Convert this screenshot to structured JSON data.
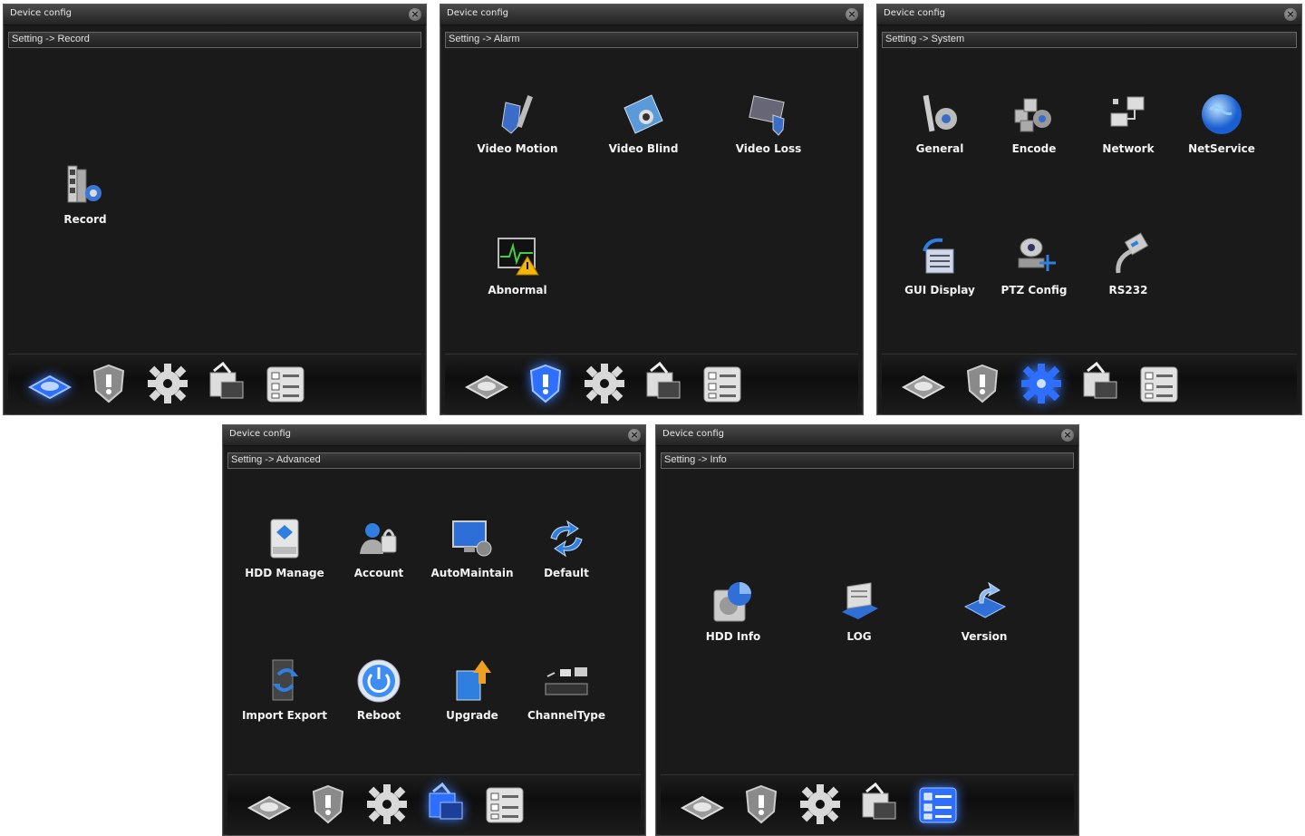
{
  "windows": [
    {
      "title": "Device config",
      "breadcrumb": "Setting -> Record",
      "active_tool": 0,
      "items": [
        {
          "label": "Record",
          "icon": "record-icon"
        }
      ]
    },
    {
      "title": "Device config",
      "breadcrumb": "Setting -> Alarm",
      "active_tool": 1,
      "items": [
        {
          "label": "Video Motion",
          "icon": "video-motion-icon"
        },
        {
          "label": "Video Blind",
          "icon": "video-blind-icon"
        },
        {
          "label": "Video Loss",
          "icon": "video-loss-icon"
        },
        {
          "label": "Abnormal",
          "icon": "abnormal-icon"
        }
      ]
    },
    {
      "title": "Device config",
      "breadcrumb": "Setting -> System",
      "active_tool": 2,
      "items": [
        {
          "label": "General",
          "icon": "general-icon"
        },
        {
          "label": "Encode",
          "icon": "encode-icon"
        },
        {
          "label": "Network",
          "icon": "network-icon"
        },
        {
          "label": "NetService",
          "icon": "netservice-icon"
        },
        {
          "label": "GUI Display",
          "icon": "gui-display-icon"
        },
        {
          "label": "PTZ Config",
          "icon": "ptz-config-icon"
        },
        {
          "label": "RS232",
          "icon": "rs232-icon"
        }
      ]
    },
    {
      "title": "Device config",
      "breadcrumb": "Setting -> Advanced",
      "active_tool": 3,
      "items": [
        {
          "label": "HDD Manage",
          "icon": "hdd-manage-icon"
        },
        {
          "label": "Account",
          "icon": "account-icon"
        },
        {
          "label": "AutoMaintain",
          "icon": "automaintain-icon"
        },
        {
          "label": "Default",
          "icon": "default-icon"
        },
        {
          "label": "Import Export",
          "icon": "import-export-icon"
        },
        {
          "label": "Reboot",
          "icon": "reboot-icon"
        },
        {
          "label": "Upgrade",
          "icon": "upgrade-icon"
        },
        {
          "label": "ChannelType",
          "icon": "channeltype-icon"
        }
      ]
    },
    {
      "title": "Device config",
      "breadcrumb": "Setting -> Info",
      "active_tool": 4,
      "items": [
        {
          "label": "HDD Info",
          "icon": "hdd-info-icon"
        },
        {
          "label": "LOG",
          "icon": "log-icon"
        },
        {
          "label": "Version",
          "icon": "version-icon"
        }
      ]
    }
  ],
  "toolbar_icons": [
    "record-tab-icon",
    "alarm-tab-icon",
    "system-tab-icon",
    "advanced-tab-icon",
    "info-tab-icon"
  ],
  "colors": {
    "accent": "#2f6fff",
    "background": "#1a1a1a",
    "text": "#f2f2f2"
  }
}
